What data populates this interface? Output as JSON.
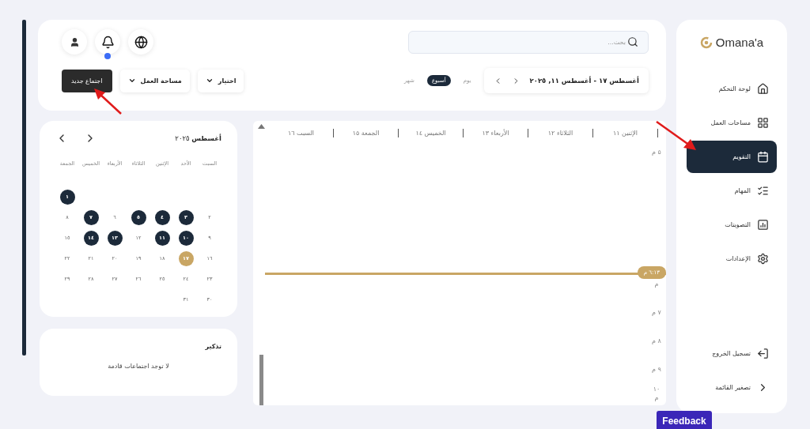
{
  "sidebar": {
    "logo": "Omana'a",
    "items": [
      {
        "label": "لوحة التحكم",
        "kind": "home",
        "selected": false
      },
      {
        "label": "مساحات العمل",
        "kind": "grid",
        "selected": false
      },
      {
        "label": "التقويم",
        "kind": "calendar",
        "selected": true
      },
      {
        "label": "المهام",
        "kind": "tasks",
        "selected": false
      },
      {
        "label": "التصويتات",
        "kind": "chart",
        "selected": false
      },
      {
        "label": "الإعدادات",
        "kind": "settings",
        "selected": false
      }
    ],
    "footer": [
      {
        "label": "تسجيل الخروج",
        "kind": "logout"
      },
      {
        "label": "تصغير القائمة",
        "kind": "collapse"
      }
    ]
  },
  "header": {
    "search": {
      "placeholder": "بحث..."
    },
    "notifications_unread": true,
    "date_range": "أغسطس ١٧ - أغسطس ١١, ٢٠٢٥",
    "views": [
      {
        "label": "يوم",
        "selected": false
      },
      {
        "label": "أسبوع",
        "selected": true
      },
      {
        "label": "شهر",
        "selected": false
      }
    ],
    "filters": [
      {
        "label": "اختيار"
      },
      {
        "label": "مساحة العمل"
      }
    ],
    "new_meeting": "اجتماع جديد"
  },
  "week": {
    "days": [
      {
        "label": "الإثنين ١١"
      },
      {
        "label": "الثلاثاء ١٢"
      },
      {
        "label": "الأربعاء ١٣"
      },
      {
        "label": "الخميس ١٤"
      },
      {
        "label": "الجمعة ١٥"
      },
      {
        "label": "السبت ١٦"
      }
    ],
    "hours": [
      "٥ م",
      "م",
      "٧ م",
      "٨ م",
      "٩ م",
      "١٠ م"
    ],
    "now": "٦:١٣ م"
  },
  "mini_calendar": {
    "title": "أغسطس",
    "year": "٢٠٢٥",
    "weekdays": [
      "السبت",
      "الأحد",
      "الإثنين",
      "الثلاثاء",
      "الأربعاء",
      "الخميس",
      "الجمعة"
    ],
    "days": [
      {
        "kind": "blank"
      },
      {
        "kind": "blank"
      },
      {
        "kind": "blank"
      },
      {
        "kind": "blank"
      },
      {
        "kind": "blank"
      },
      {
        "kind": "blank"
      },
      {
        "kind": "day",
        "n": "١",
        "has_meeting": true,
        "today": false
      },
      {
        "kind": "day",
        "n": "٢",
        "has_meeting": false,
        "today": false
      },
      {
        "kind": "day",
        "n": "٣",
        "has_meeting": true,
        "today": false
      },
      {
        "kind": "day",
        "n": "٤",
        "has_meeting": true,
        "today": false
      },
      {
        "kind": "day",
        "n": "٥",
        "has_meeting": true,
        "today": false
      },
      {
        "kind": "day",
        "n": "٦",
        "has_meeting": false,
        "today": false
      },
      {
        "kind": "day",
        "n": "٧",
        "has_meeting": true,
        "today": false
      },
      {
        "kind": "day",
        "n": "٨",
        "has_meeting": false,
        "today": false
      },
      {
        "kind": "day",
        "n": "٩",
        "has_meeting": false,
        "today": false
      },
      {
        "kind": "day",
        "n": "١٠",
        "has_meeting": true,
        "today": false
      },
      {
        "kind": "day",
        "n": "١١",
        "has_meeting": true,
        "today": false
      },
      {
        "kind": "day",
        "n": "١٢",
        "has_meeting": false,
        "today": false
      },
      {
        "kind": "day",
        "n": "١٣",
        "has_meeting": true,
        "today": false
      },
      {
        "kind": "day",
        "n": "١٤",
        "has_meeting": true,
        "today": false
      },
      {
        "kind": "day",
        "n": "١٥",
        "has_meeting": false,
        "today": false
      },
      {
        "kind": "day",
        "n": "١٦",
        "has_meeting": false,
        "today": false
      },
      {
        "kind": "day",
        "n": "١٧",
        "has_meeting": false,
        "today": true
      },
      {
        "kind": "day",
        "n": "١٨",
        "has_meeting": false,
        "today": false
      },
      {
        "kind": "day",
        "n": "١٩",
        "has_meeting": false,
        "today": false
      },
      {
        "kind": "day",
        "n": "٢٠",
        "has_meeting": false,
        "today": false
      },
      {
        "kind": "day",
        "n": "٢١",
        "has_meeting": false,
        "today": false
      },
      {
        "kind": "day",
        "n": "٢٢",
        "has_meeting": false,
        "today": false
      },
      {
        "kind": "day",
        "n": "٢٣",
        "has_meeting": false,
        "today": false
      },
      {
        "kind": "day",
        "n": "٢٤",
        "has_meeting": false,
        "today": false
      },
      {
        "kind": "day",
        "n": "٢٥",
        "has_meeting": false,
        "today": false
      },
      {
        "kind": "day",
        "n": "٢٦",
        "has_meeting": false,
        "today": false
      },
      {
        "kind": "day",
        "n": "٢٧",
        "has_meeting": false,
        "today": false
      },
      {
        "kind": "day",
        "n": "٢٨",
        "has_meeting": false,
        "today": false
      },
      {
        "kind": "day",
        "n": "٢٩",
        "has_meeting": false,
        "today": false
      },
      {
        "kind": "day",
        "n": "٣٠",
        "has_meeting": false,
        "today": false
      },
      {
        "kind": "day",
        "n": "٣١",
        "has_meeting": false,
        "today": false
      }
    ]
  },
  "reminders": {
    "title": "تذكير",
    "empty": "لا توجد اجتماعات قادمة"
  },
  "feedback": "Feedback"
}
